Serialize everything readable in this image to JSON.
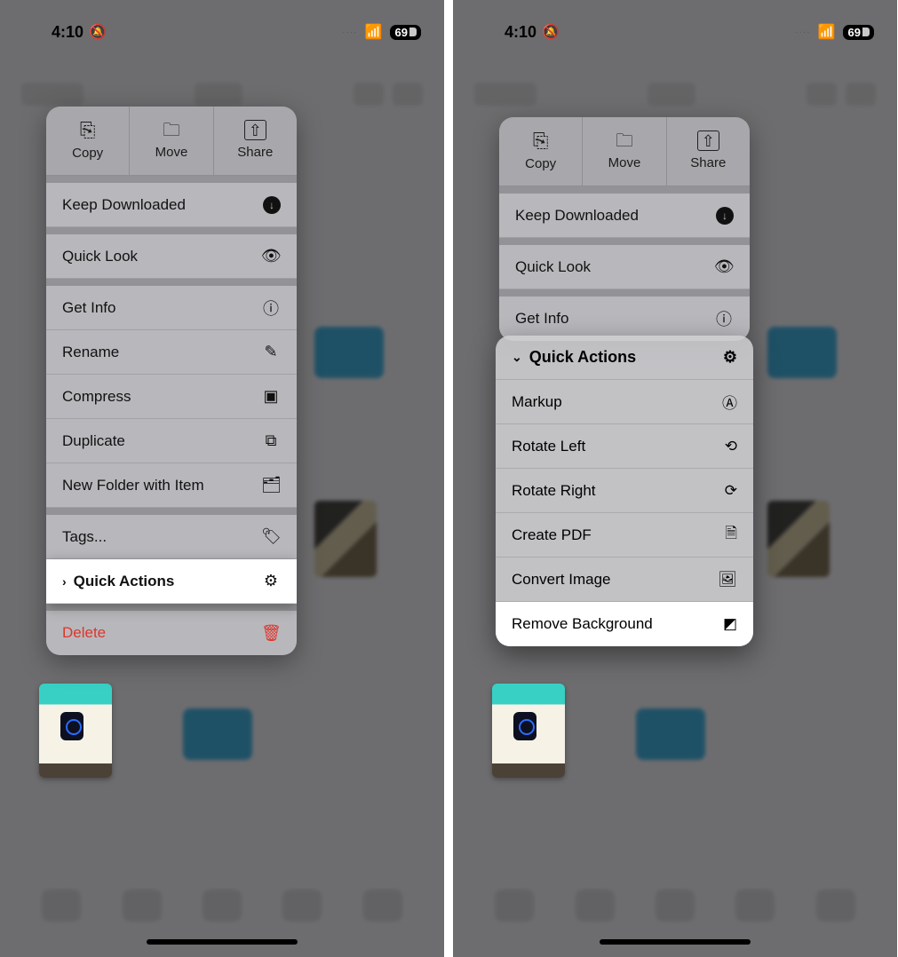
{
  "status": {
    "time": "4:10",
    "dots": "····",
    "battery": "69"
  },
  "left": {
    "top": {
      "copy": "Copy",
      "move": "Move",
      "share": "Share"
    },
    "rows": {
      "keep": "Keep Downloaded",
      "quicklook": "Quick Look",
      "info": "Get Info",
      "rename": "Rename",
      "compress": "Compress",
      "duplicate": "Duplicate",
      "newfolder": "New Folder with Item",
      "tags": "Tags...",
      "quickactions": "Quick Actions",
      "delete": "Delete"
    }
  },
  "right": {
    "top": {
      "copy": "Copy",
      "move": "Move",
      "share": "Share"
    },
    "rows": {
      "keep": "Keep Downloaded",
      "quicklook": "Quick Look",
      "info": "Get Info"
    },
    "submenu": {
      "title": "Quick Actions",
      "markup": "Markup",
      "rotl": "Rotate Left",
      "rotr": "Rotate Right",
      "pdf": "Create PDF",
      "conv": "Convert Image",
      "rmbg": "Remove Background"
    }
  }
}
